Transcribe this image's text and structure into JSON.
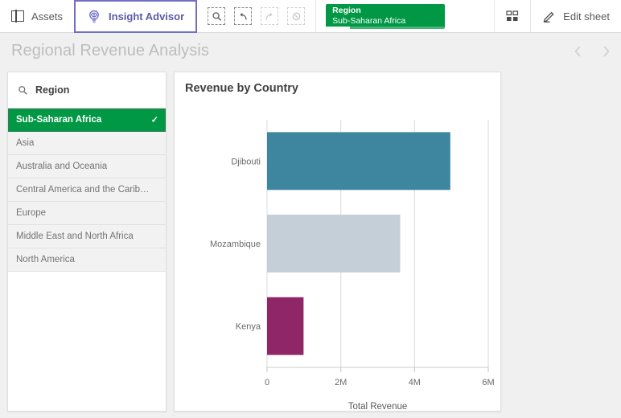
{
  "toolbar": {
    "assets_label": "Assets",
    "assets_icon": "panel-icon",
    "insight_advisor_label": "Insight Advisor",
    "insight_advisor_icon": "insight-advisor-icon",
    "selection_tools": [
      {
        "name": "selection-search",
        "icon": "search-icon",
        "enabled": true
      },
      {
        "name": "step-back",
        "icon": "undo-arrow-icon",
        "enabled": true
      },
      {
        "name": "step-forward",
        "icon": "redo-arrow-icon",
        "enabled": false
      },
      {
        "name": "clear-all-selections",
        "icon": "clear-circle-icon",
        "enabled": false
      }
    ],
    "selection_chip": {
      "field": "Region",
      "value": "Sub-Saharan Africa",
      "color": "#009845"
    },
    "sheet_grid_icon": "sheet-grid-icon",
    "edit_sheet_label": "Edit sheet",
    "edit_sheet_icon": "pencil-icon",
    "active_tab_accent": "#6f6fc5"
  },
  "sheet": {
    "title": "Regional Revenue Analysis",
    "nav_prev_icon": "chevron-left-icon",
    "nav_next_icon": "chevron-right-icon"
  },
  "filter_pane": {
    "field_title": "Region",
    "search_icon": "search-icon",
    "check_glyph": "✓",
    "items": [
      {
        "label": "Sub-Saharan Africa",
        "selected": true
      },
      {
        "label": "Asia",
        "selected": false
      },
      {
        "label": "Australia and Oceania",
        "selected": false
      },
      {
        "label": "Central America and the Carib…",
        "selected": false
      },
      {
        "label": "Europe",
        "selected": false
      },
      {
        "label": "Middle East and North Africa",
        "selected": false
      },
      {
        "label": "North America",
        "selected": false
      }
    ]
  },
  "chart_panel": {
    "title": "Revenue by Country"
  },
  "chart_data": {
    "type": "bar",
    "orientation": "horizontal",
    "title": "Revenue by Country",
    "categories": [
      "Djibouti",
      "Mozambique",
      "Kenya"
    ],
    "values": [
      4.97,
      3.61,
      0.99
    ],
    "value_unit": "M",
    "colors": [
      "#3e86a0",
      "#c5cfd8",
      "#8e2667"
    ],
    "xlabel": "Total Revenue",
    "ylabel": "",
    "xlim": [
      0,
      6
    ],
    "xticks": [
      0,
      2,
      4,
      6
    ],
    "xtick_labels": [
      "0",
      "2M",
      "4M",
      "6M"
    ],
    "grid": true,
    "legend": "none"
  }
}
